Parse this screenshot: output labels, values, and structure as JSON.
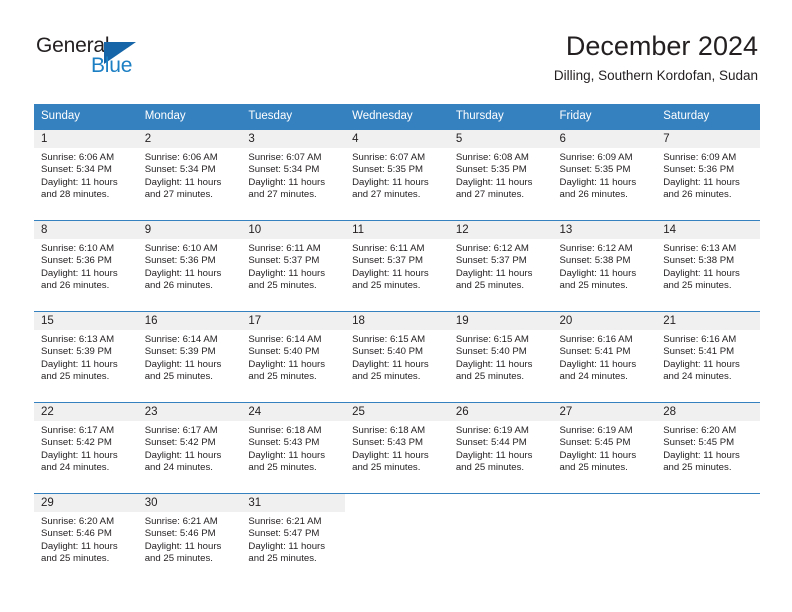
{
  "brand": {
    "name_part1": "General",
    "name_part2": "Blue",
    "triangle_color": "#1565A8",
    "blue_text_color": "#1C7FC4",
    "logo_icon": "triangle-flag-icon"
  },
  "header": {
    "title": "December 2024",
    "subtitle": "Dilling, Southern Kordofan, Sudan"
  },
  "theme": {
    "header_row_bg": "#3580BF",
    "header_row_text": "#FFFFFF",
    "daynum_band_bg": "#F0F0F0",
    "row_border": "#3580BF",
    "body_text": "#231F20"
  },
  "calendar": {
    "weekday_headers": [
      "Sunday",
      "Monday",
      "Tuesday",
      "Wednesday",
      "Thursday",
      "Friday",
      "Saturday"
    ],
    "labels": {
      "sunrise_prefix": "Sunrise:",
      "sunset_prefix": "Sunset:",
      "daylight_prefix": "Daylight:"
    },
    "weeks": [
      [
        {
          "day": "1",
          "sunrise": "Sunrise: 6:06 AM",
          "sunset": "Sunset: 5:34 PM",
          "daylight_line1": "Daylight: 11 hours",
          "daylight_line2": "and 28 minutes."
        },
        {
          "day": "2",
          "sunrise": "Sunrise: 6:06 AM",
          "sunset": "Sunset: 5:34 PM",
          "daylight_line1": "Daylight: 11 hours",
          "daylight_line2": "and 27 minutes."
        },
        {
          "day": "3",
          "sunrise": "Sunrise: 6:07 AM",
          "sunset": "Sunset: 5:34 PM",
          "daylight_line1": "Daylight: 11 hours",
          "daylight_line2": "and 27 minutes."
        },
        {
          "day": "4",
          "sunrise": "Sunrise: 6:07 AM",
          "sunset": "Sunset: 5:35 PM",
          "daylight_line1": "Daylight: 11 hours",
          "daylight_line2": "and 27 minutes."
        },
        {
          "day": "5",
          "sunrise": "Sunrise: 6:08 AM",
          "sunset": "Sunset: 5:35 PM",
          "daylight_line1": "Daylight: 11 hours",
          "daylight_line2": "and 27 minutes."
        },
        {
          "day": "6",
          "sunrise": "Sunrise: 6:09 AM",
          "sunset": "Sunset: 5:35 PM",
          "daylight_line1": "Daylight: 11 hours",
          "daylight_line2": "and 26 minutes."
        },
        {
          "day": "7",
          "sunrise": "Sunrise: 6:09 AM",
          "sunset": "Sunset: 5:36 PM",
          "daylight_line1": "Daylight: 11 hours",
          "daylight_line2": "and 26 minutes."
        }
      ],
      [
        {
          "day": "8",
          "sunrise": "Sunrise: 6:10 AM",
          "sunset": "Sunset: 5:36 PM",
          "daylight_line1": "Daylight: 11 hours",
          "daylight_line2": "and 26 minutes."
        },
        {
          "day": "9",
          "sunrise": "Sunrise: 6:10 AM",
          "sunset": "Sunset: 5:36 PM",
          "daylight_line1": "Daylight: 11 hours",
          "daylight_line2": "and 26 minutes."
        },
        {
          "day": "10",
          "sunrise": "Sunrise: 6:11 AM",
          "sunset": "Sunset: 5:37 PM",
          "daylight_line1": "Daylight: 11 hours",
          "daylight_line2": "and 25 minutes."
        },
        {
          "day": "11",
          "sunrise": "Sunrise: 6:11 AM",
          "sunset": "Sunset: 5:37 PM",
          "daylight_line1": "Daylight: 11 hours",
          "daylight_line2": "and 25 minutes."
        },
        {
          "day": "12",
          "sunrise": "Sunrise: 6:12 AM",
          "sunset": "Sunset: 5:37 PM",
          "daylight_line1": "Daylight: 11 hours",
          "daylight_line2": "and 25 minutes."
        },
        {
          "day": "13",
          "sunrise": "Sunrise: 6:12 AM",
          "sunset": "Sunset: 5:38 PM",
          "daylight_line1": "Daylight: 11 hours",
          "daylight_line2": "and 25 minutes."
        },
        {
          "day": "14",
          "sunrise": "Sunrise: 6:13 AM",
          "sunset": "Sunset: 5:38 PM",
          "daylight_line1": "Daylight: 11 hours",
          "daylight_line2": "and 25 minutes."
        }
      ],
      [
        {
          "day": "15",
          "sunrise": "Sunrise: 6:13 AM",
          "sunset": "Sunset: 5:39 PM",
          "daylight_line1": "Daylight: 11 hours",
          "daylight_line2": "and 25 minutes."
        },
        {
          "day": "16",
          "sunrise": "Sunrise: 6:14 AM",
          "sunset": "Sunset: 5:39 PM",
          "daylight_line1": "Daylight: 11 hours",
          "daylight_line2": "and 25 minutes."
        },
        {
          "day": "17",
          "sunrise": "Sunrise: 6:14 AM",
          "sunset": "Sunset: 5:40 PM",
          "daylight_line1": "Daylight: 11 hours",
          "daylight_line2": "and 25 minutes."
        },
        {
          "day": "18",
          "sunrise": "Sunrise: 6:15 AM",
          "sunset": "Sunset: 5:40 PM",
          "daylight_line1": "Daylight: 11 hours",
          "daylight_line2": "and 25 minutes."
        },
        {
          "day": "19",
          "sunrise": "Sunrise: 6:15 AM",
          "sunset": "Sunset: 5:40 PM",
          "daylight_line1": "Daylight: 11 hours",
          "daylight_line2": "and 25 minutes."
        },
        {
          "day": "20",
          "sunrise": "Sunrise: 6:16 AM",
          "sunset": "Sunset: 5:41 PM",
          "daylight_line1": "Daylight: 11 hours",
          "daylight_line2": "and 24 minutes."
        },
        {
          "day": "21",
          "sunrise": "Sunrise: 6:16 AM",
          "sunset": "Sunset: 5:41 PM",
          "daylight_line1": "Daylight: 11 hours",
          "daylight_line2": "and 24 minutes."
        }
      ],
      [
        {
          "day": "22",
          "sunrise": "Sunrise: 6:17 AM",
          "sunset": "Sunset: 5:42 PM",
          "daylight_line1": "Daylight: 11 hours",
          "daylight_line2": "and 24 minutes."
        },
        {
          "day": "23",
          "sunrise": "Sunrise: 6:17 AM",
          "sunset": "Sunset: 5:42 PM",
          "daylight_line1": "Daylight: 11 hours",
          "daylight_line2": "and 24 minutes."
        },
        {
          "day": "24",
          "sunrise": "Sunrise: 6:18 AM",
          "sunset": "Sunset: 5:43 PM",
          "daylight_line1": "Daylight: 11 hours",
          "daylight_line2": "and 25 minutes."
        },
        {
          "day": "25",
          "sunrise": "Sunrise: 6:18 AM",
          "sunset": "Sunset: 5:43 PM",
          "daylight_line1": "Daylight: 11 hours",
          "daylight_line2": "and 25 minutes."
        },
        {
          "day": "26",
          "sunrise": "Sunrise: 6:19 AM",
          "sunset": "Sunset: 5:44 PM",
          "daylight_line1": "Daylight: 11 hours",
          "daylight_line2": "and 25 minutes."
        },
        {
          "day": "27",
          "sunrise": "Sunrise: 6:19 AM",
          "sunset": "Sunset: 5:45 PM",
          "daylight_line1": "Daylight: 11 hours",
          "daylight_line2": "and 25 minutes."
        },
        {
          "day": "28",
          "sunrise": "Sunrise: 6:20 AM",
          "sunset": "Sunset: 5:45 PM",
          "daylight_line1": "Daylight: 11 hours",
          "daylight_line2": "and 25 minutes."
        }
      ],
      [
        {
          "day": "29",
          "sunrise": "Sunrise: 6:20 AM",
          "sunset": "Sunset: 5:46 PM",
          "daylight_line1": "Daylight: 11 hours",
          "daylight_line2": "and 25 minutes."
        },
        {
          "day": "30",
          "sunrise": "Sunrise: 6:21 AM",
          "sunset": "Sunset: 5:46 PM",
          "daylight_line1": "Daylight: 11 hours",
          "daylight_line2": "and 25 minutes."
        },
        {
          "day": "31",
          "sunrise": "Sunrise: 6:21 AM",
          "sunset": "Sunset: 5:47 PM",
          "daylight_line1": "Daylight: 11 hours",
          "daylight_line2": "and 25 minutes."
        },
        {
          "day": "",
          "sunrise": "",
          "sunset": "",
          "daylight_line1": "",
          "daylight_line2": ""
        },
        {
          "day": "",
          "sunrise": "",
          "sunset": "",
          "daylight_line1": "",
          "daylight_line2": ""
        },
        {
          "day": "",
          "sunrise": "",
          "sunset": "",
          "daylight_line1": "",
          "daylight_line2": ""
        },
        {
          "day": "",
          "sunrise": "",
          "sunset": "",
          "daylight_line1": "",
          "daylight_line2": ""
        }
      ]
    ]
  }
}
